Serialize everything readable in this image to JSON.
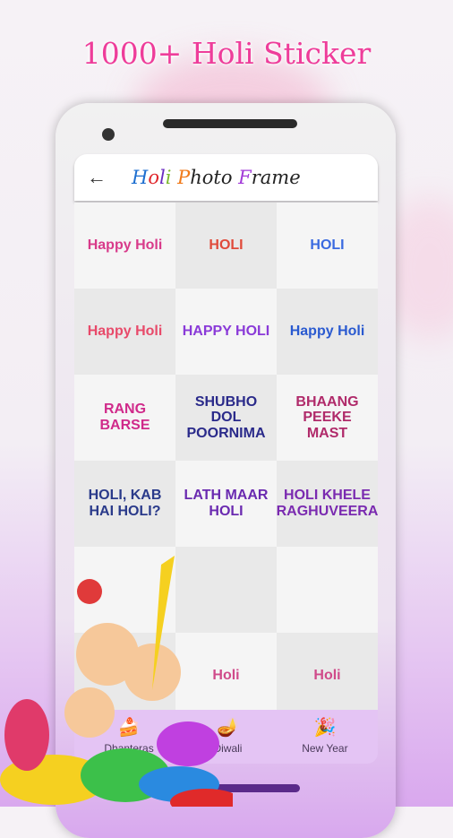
{
  "headline": "1000+ Holi Sticker",
  "header": {
    "back_icon": "arrow-left-icon",
    "title_parts": [
      {
        "text": "H",
        "color": "#1e6fd0"
      },
      {
        "text": "o",
        "color": "#e0262b"
      },
      {
        "text": "l",
        "color": "#6a2bc0"
      },
      {
        "text": "i",
        "color": "#7cb82f"
      },
      {
        "text": " P",
        "color": "#f07a1a"
      },
      {
        "text": "hoto ",
        "color": "#222222"
      },
      {
        "text": "F",
        "color": "#a23ad8"
      },
      {
        "text": "rame",
        "color": "#222222"
      }
    ]
  },
  "stickers": [
    {
      "text": "Happy Holi",
      "color": "#d83a8a"
    },
    {
      "text": "HOLI",
      "color": "#e04a3a"
    },
    {
      "text": "HOLI",
      "color": "#3a6ae0"
    },
    {
      "text": "Happy Holi",
      "color": "#e84a6a"
    },
    {
      "text": "HAPPY HOLI",
      "color": "#8a3ad8"
    },
    {
      "text": "Happy Holi",
      "color": "#2a5ad0"
    },
    {
      "text": "RANG BARSE",
      "color": "#d02a8a"
    },
    {
      "text": "SHUBHO DOL POORNIMA",
      "color": "#2a2a8a"
    },
    {
      "text": "BHAANG PEEKE MAST",
      "color": "#b02a6a"
    },
    {
      "text": "HOLI, KAB HAI HOLI?",
      "color": "#2a3a8a"
    },
    {
      "text": "LATH MAAR HOLI",
      "color": "#6a2ab0"
    },
    {
      "text": "HOLI KHELE RAGHUVEERA",
      "color": "#7a2ab0"
    },
    {
      "text": "",
      "color": "#d04a8a"
    },
    {
      "text": "",
      "color": "#d04a8a"
    },
    {
      "text": "",
      "color": "#d04a8a"
    },
    {
      "text": "",
      "color": "#d04a8a"
    },
    {
      "text": "Holi",
      "color": "#d04a8a"
    },
    {
      "text": "Holi",
      "color": "#d04a8a"
    }
  ],
  "bottom_nav": [
    {
      "label": "Dhanteras",
      "icon": "sweets-icon"
    },
    {
      "label": "Diwali",
      "icon": "diya-icon"
    },
    {
      "label": "New Year",
      "icon": "party-hat-icon"
    }
  ]
}
